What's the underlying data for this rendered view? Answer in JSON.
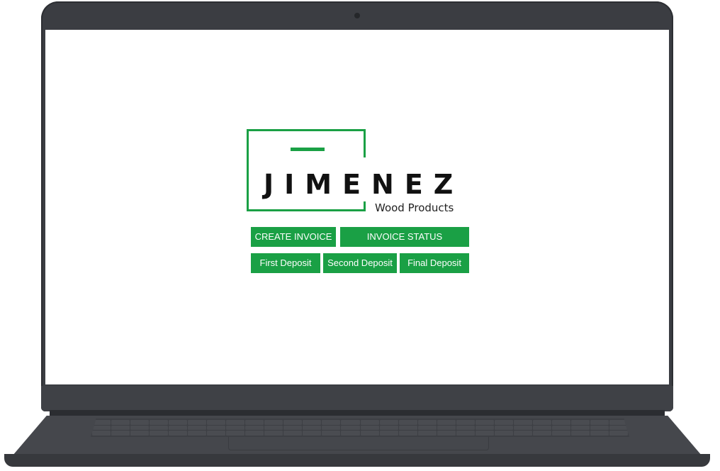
{
  "brand": {
    "name": "JIMENEZ",
    "tagline": "Wood Products",
    "accent_color": "#1aa045"
  },
  "actions": {
    "create_invoice": "CREATE INVOICE",
    "invoice_status": "INVOICE STATUS",
    "first_deposit": "First Deposit",
    "second_deposit": "Second Deposit",
    "final_deposit": "Final Deposit"
  }
}
